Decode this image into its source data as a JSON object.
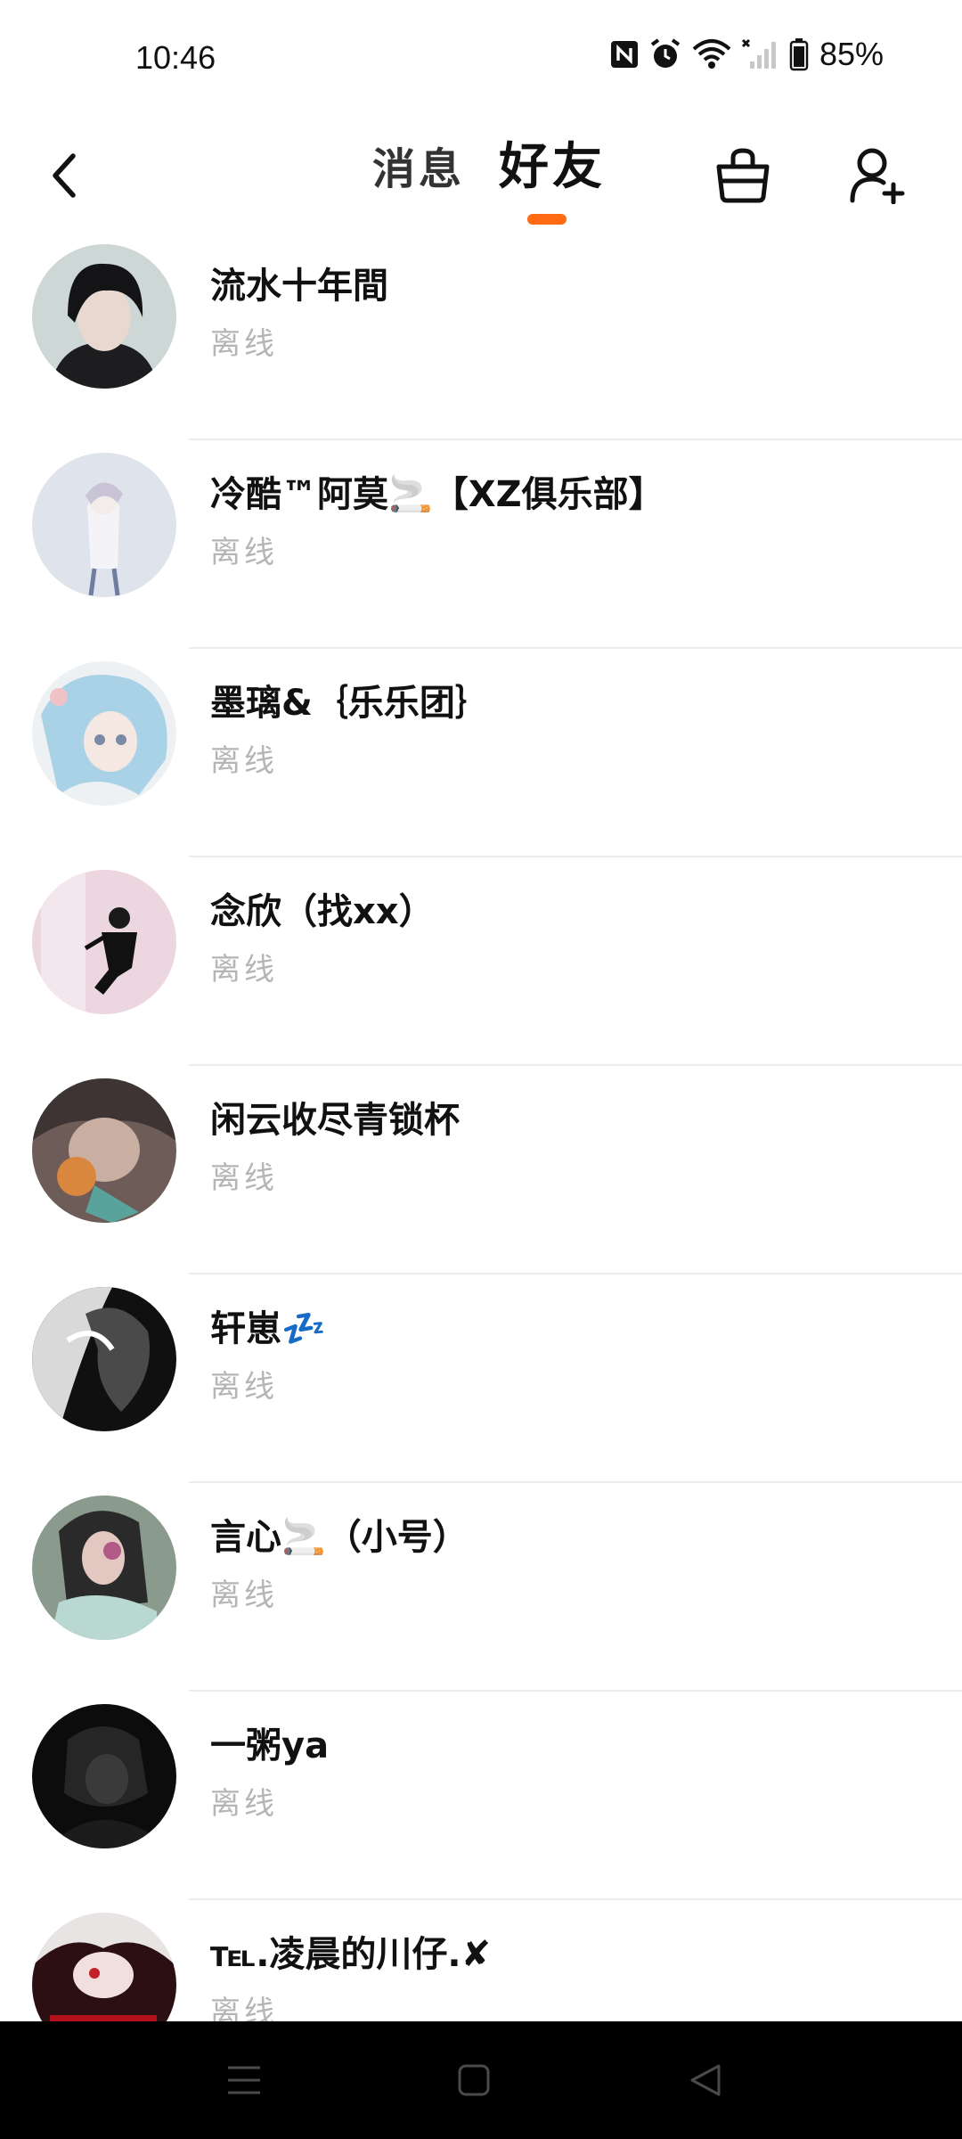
{
  "status_bar": {
    "time": "10:46",
    "battery": "85%",
    "icons": [
      "nfc-icon",
      "alarm-icon",
      "wifi-icon",
      "cellular-no-signal-icon",
      "battery-icon"
    ]
  },
  "header": {
    "back_icon": "chevron-left-icon",
    "tabs": [
      {
        "label": "消息",
        "active": false
      },
      {
        "label": "好友",
        "active": true
      }
    ],
    "accent_color": "#ff6a13",
    "right_icons": [
      "clean-basket-icon",
      "add-friend-icon"
    ]
  },
  "friends": [
    {
      "name": "流水十年間",
      "status": "离线"
    },
    {
      "name": "冷酷™阿莫🚬【XZ俱乐部】",
      "status": "离线"
    },
    {
      "name": "墨璃&｛乐乐团｝",
      "status": "离线"
    },
    {
      "name": "念欣（找xx）",
      "status": "离线"
    },
    {
      "name": "闲云收尽青锁杯",
      "status": "离线"
    },
    {
      "name": "轩崽💤",
      "status": "离线"
    },
    {
      "name": "言心🚬（小号）",
      "status": "离线"
    },
    {
      "name": "一粥ya",
      "status": "离线"
    },
    {
      "name": "℡.凌晨的川仔.✘",
      "status": "离线"
    }
  ],
  "nav_bar": {
    "icons": [
      "menu-icon",
      "home-square-icon",
      "back-triangle-icon"
    ]
  }
}
